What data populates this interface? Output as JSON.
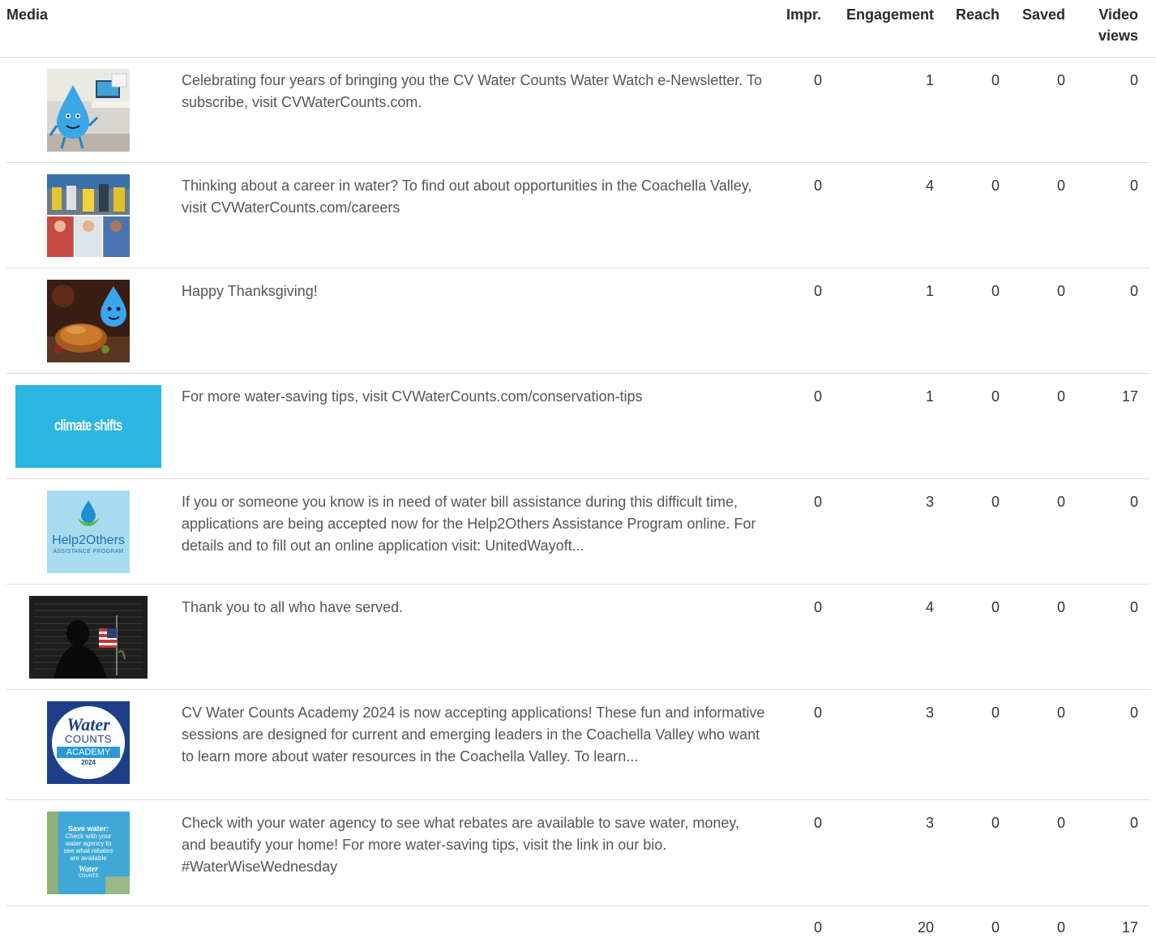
{
  "columns": {
    "media": "Media",
    "impr": "Impr.",
    "engagement": "Engagement",
    "reach": "Reach",
    "saved": "Saved",
    "video_views_1": "Video",
    "video_views_2": "views"
  },
  "rows": [
    {
      "caption": "Celebrating four years of bringing you the CV Water Counts Water Watch e-Newsletter. To subscribe, visit CVWaterCounts.com.",
      "impr": "0",
      "engagement": "1",
      "reach": "0",
      "saved": "0",
      "video_views": "0",
      "thumb": "water-drop-mascot-desk"
    },
    {
      "caption": "Thinking about a career in water? To find out about opportunities in the Coachella Valley, visit CVWaterCounts.com/careers",
      "impr": "0",
      "engagement": "4",
      "reach": "0",
      "saved": "0",
      "video_views": "0",
      "thumb": "water-careers-collage"
    },
    {
      "caption": "Happy Thanksgiving!",
      "impr": "0",
      "engagement": "1",
      "reach": "0",
      "saved": "0",
      "video_views": "0",
      "thumb": "thanksgiving-turkey-mascot"
    },
    {
      "caption": "For more water-saving tips, visit CVWaterCounts.com/conservation-tips",
      "impr": "0",
      "engagement": "1",
      "reach": "0",
      "saved": "0",
      "video_views": "17",
      "thumb": "climate-shifts-video",
      "thumb_text": "climate shifts"
    },
    {
      "caption": "If you or someone you know is in need of water bill assistance during this difficult time, applications are being accepted now for the Help2Others Assistance Program online. For details and to fill out an online application visit: UnitedWayoft...",
      "impr": "0",
      "engagement": "3",
      "reach": "0",
      "saved": "0",
      "video_views": "0",
      "thumb": "help2others-logo",
      "thumb_text": "Help2Others",
      "thumb_sub": "ASSISTANCE PROGRAM"
    },
    {
      "caption": "Thank you to all who have served.",
      "impr": "0",
      "engagement": "4",
      "reach": "0",
      "saved": "0",
      "video_views": "0",
      "thumb": "memorial-wall-flag"
    },
    {
      "caption": "CV Water Counts Academy 2024 is now accepting applications! These fun and informative sessions are designed for current and emerging leaders in the Coachella Valley who want to learn more about water resources in the Coachella Valley. To learn...",
      "impr": "0",
      "engagement": "3",
      "reach": "0",
      "saved": "0",
      "video_views": "0",
      "thumb": "water-counts-academy-logo",
      "thumb_text_1": "Water",
      "thumb_text_2": "COUNTS",
      "thumb_text_3": "ACADEMY",
      "thumb_text_4": "2024"
    },
    {
      "caption": "Check with your water agency to see what rebates are available to save water, money, and beautify your home! For more water-saving tips, visit the link in our bio. #WaterWiseWednesday",
      "impr": "0",
      "engagement": "3",
      "reach": "0",
      "saved": "0",
      "video_views": "0",
      "thumb": "save-water-rebates",
      "thumb_text_1": "Save water:",
      "thumb_text_2": "Check with your water agency to see what rebates are available",
      "thumb_text_3": "Water",
      "thumb_text_4": "COUNTS"
    }
  ],
  "totals": {
    "impr": "0",
    "engagement": "20",
    "reach": "0",
    "saved": "0",
    "video_views": "17"
  },
  "colors": {
    "border": "#dcdcdc",
    "caption": "#555555",
    "climate_blue": "#29b6e0",
    "help_bg": "#a8dcef",
    "academy_navy": "#1d3f8a"
  }
}
